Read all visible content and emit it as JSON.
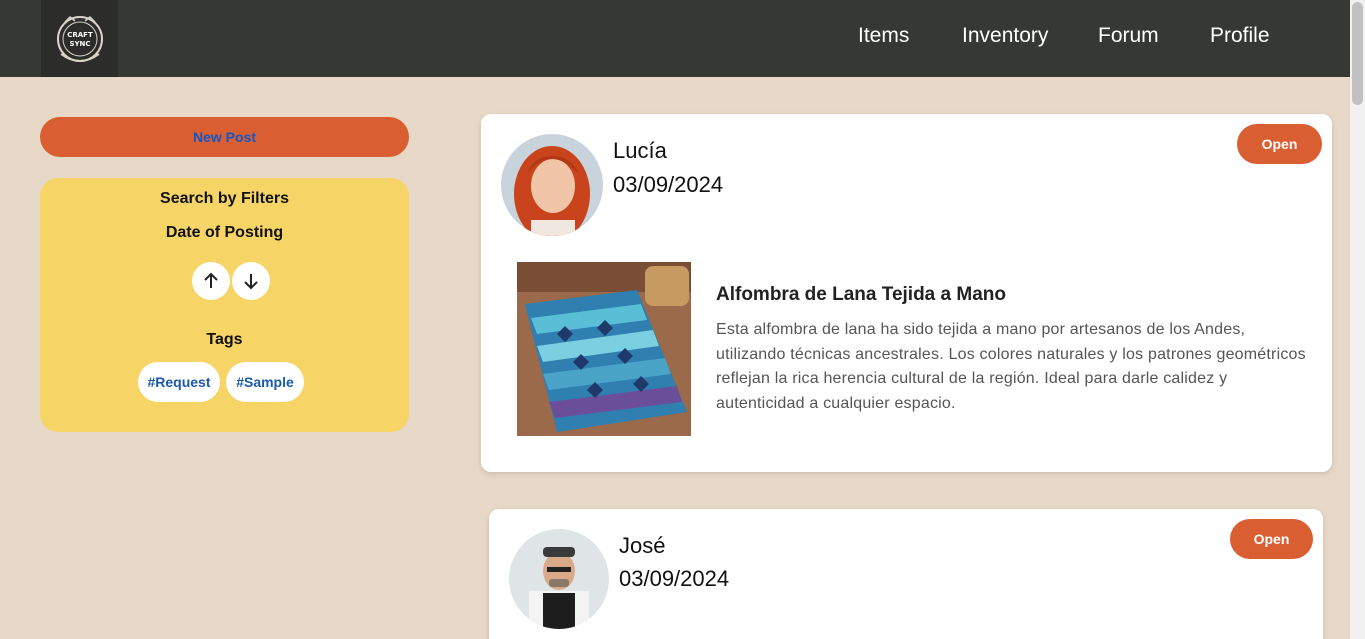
{
  "app": {
    "logo_text_top": "CRAFT",
    "logo_text_bottom": "SYNC"
  },
  "nav": {
    "items": [
      {
        "label": "Items"
      },
      {
        "label": "Inventory"
      },
      {
        "label": "Forum"
      },
      {
        "label": "Profile"
      }
    ]
  },
  "sidebar": {
    "new_post_label": "New Post",
    "filters_title": "Search by Filters",
    "date_label": "Date of Posting",
    "tags_label": "Tags",
    "tags": [
      {
        "label": "#Request"
      },
      {
        "label": "#Sample"
      }
    ]
  },
  "posts": [
    {
      "author": "Lucía",
      "date": "03/09/2024",
      "status": "Open",
      "title": "Alfombra de Lana Tejida a Mano",
      "body": "Esta alfombra de lana ha sido tejida a mano por artesanos de los Andes, utilizando técnicas ancestrales. Los colores naturales y los patrones geométricos reflejan la rica herencia cultural de la región. Ideal para darle calidez y autenticidad a cualquier espacio."
    },
    {
      "author": "José",
      "date": "03/09/2024",
      "status": "Open"
    }
  ],
  "colors": {
    "background": "#e8d8c8",
    "topbar": "#363833",
    "accent": "#d95f33",
    "filters_panel": "#f6d466",
    "tag_text": "#1a5aa8"
  }
}
